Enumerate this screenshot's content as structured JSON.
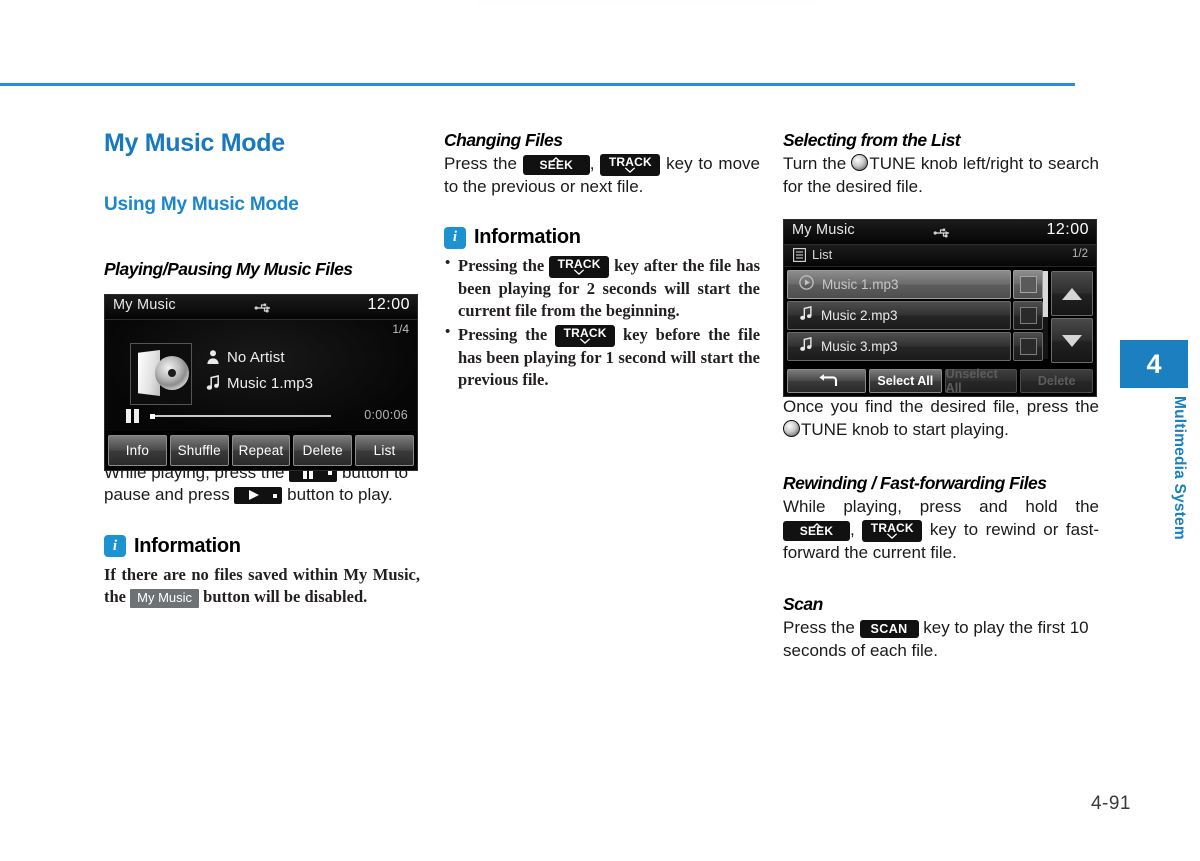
{
  "page": {
    "number": "4-91",
    "chapter_number": "4",
    "chapter_label": "Multimedia System"
  },
  "left_column": {
    "title": "My Music Mode",
    "subtitle": "Using My Music Mode",
    "section_heading": "Playing/Pausing My Music Files",
    "caption_part1": "While playing, press the",
    "caption_part2": "button to pause and press",
    "caption_part3": "button to play.",
    "info_label": "Information",
    "info_text_part1": "If there are no files saved within My Music, the",
    "info_chip": "My Music",
    "info_text_part2": "button will be disabled."
  },
  "middle_column": {
    "section_heading": "Changing Files",
    "text_part1": "Press the",
    "key_seek": "SEEK",
    "key_track": "TRACK",
    "text_part2": "key to move to the previous or next file.",
    "info_label": "Information",
    "bullets": [
      {
        "part1": "Pressing the",
        "key": "TRACK",
        "part2": "key after the file has been playing for 2 seconds will start the current file from the beginning."
      },
      {
        "part1": "Pressing the",
        "key": "TRACK",
        "part2": "key before the file has been playing for 1 second will start the previous file."
      }
    ]
  },
  "right_column": {
    "section_heading": "Selecting from the List",
    "intro_part1": "Turn the",
    "intro_knob": "TUNE",
    "intro_part2": "knob left/right to search for the desired file.",
    "after_part1": "Once you find the desired file, press the",
    "after_knob": "TUNE",
    "after_part2": "knob to start playing.",
    "rewind_heading": "Rewinding / Fast-forwarding Files",
    "rewind_part1": "While playing, press and hold the",
    "key_seek": "SEEK",
    "key_track": "TRACK",
    "rewind_part2": "key to rewind or fast-forward the current file.",
    "scan_heading": "Scan",
    "scan_part1": "Press the",
    "key_scan": "SCAN",
    "scan_part2": "key to play the first 10 seconds of each file."
  },
  "screen_now_playing": {
    "title": "My Music",
    "clock": "12:00",
    "track_index": "1/4",
    "artist": "No Artist",
    "file_name": "Music 1.mp3",
    "elapsed": "0:00:06",
    "buttons": [
      "Info",
      "Shuffle",
      "Repeat",
      "Delete",
      "List"
    ]
  },
  "screen_list": {
    "title": "My Music",
    "clock": "12:00",
    "list_label": "List",
    "page_indicator": "1/2",
    "rows": [
      {
        "name": "Music 1.mp3",
        "selected": true
      },
      {
        "name": "Music 2.mp3",
        "selected": false
      },
      {
        "name": "Music 3.mp3",
        "selected": false
      }
    ],
    "footer_buttons": [
      {
        "label": "",
        "icon": "back-arrow-icon",
        "disabled": false
      },
      {
        "label": "Select All",
        "disabled": false
      },
      {
        "label": "Unselect All",
        "disabled": true
      },
      {
        "label": "Delete",
        "disabled": true
      }
    ]
  },
  "colors": {
    "accent_blue": "#1879bf",
    "rule_blue": "#2a8fcd",
    "info_badge_blue": "#1d92d0"
  }
}
